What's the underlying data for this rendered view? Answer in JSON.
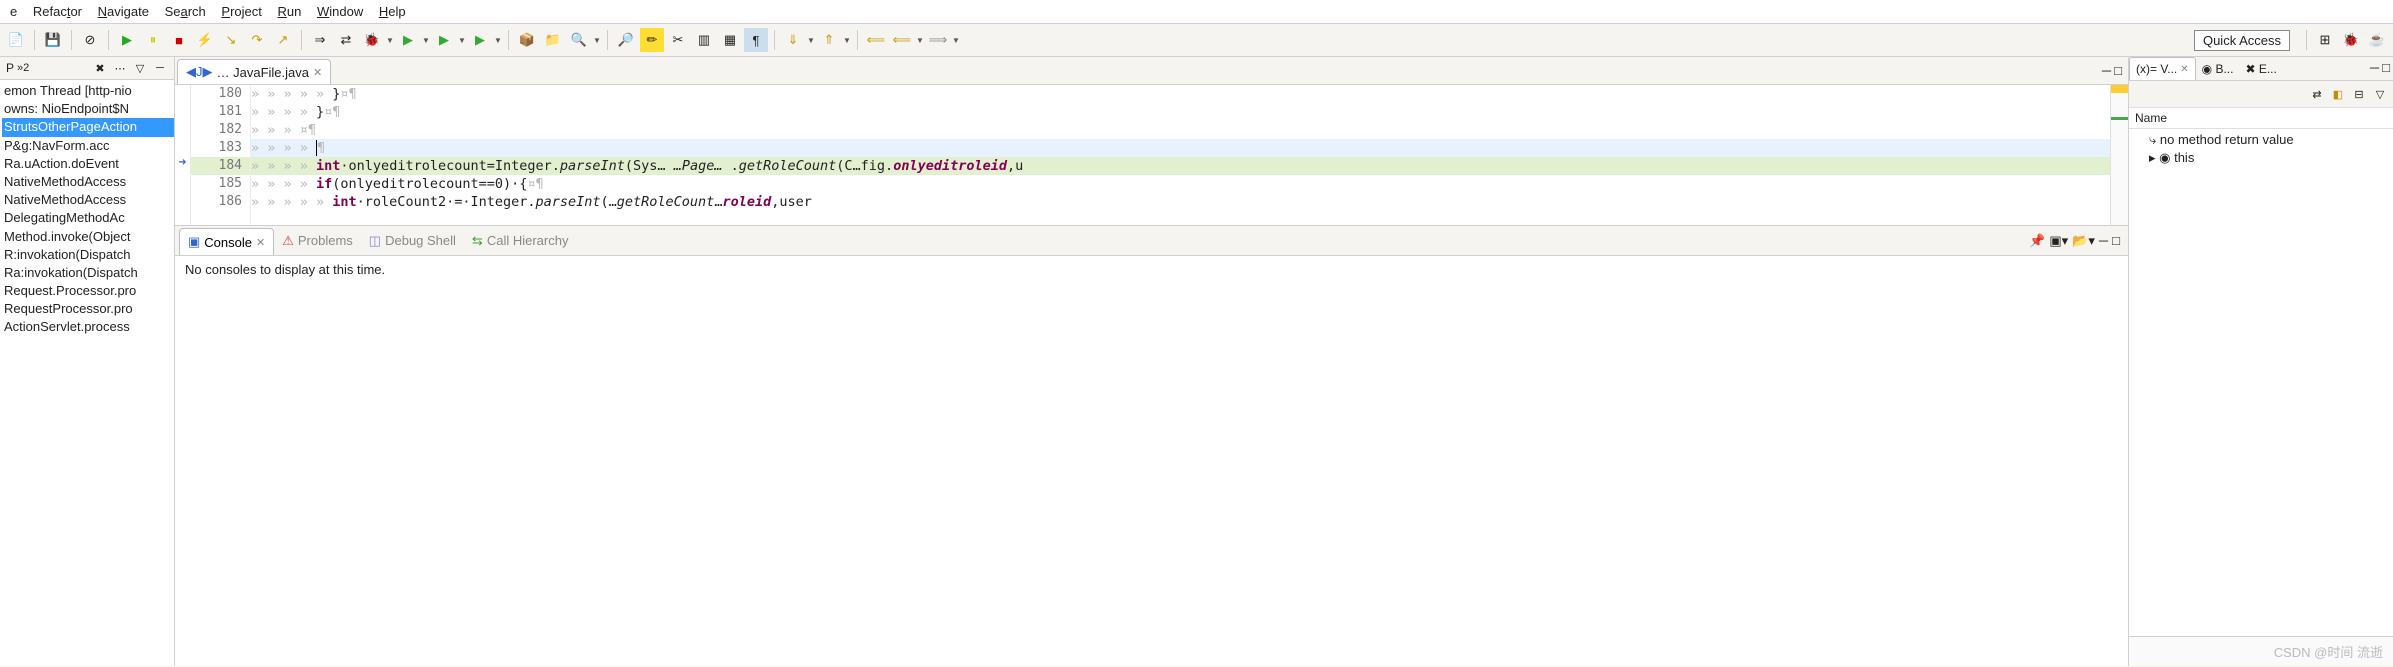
{
  "menu": [
    "e",
    "Refactor",
    "Navigate",
    "Search",
    "Project",
    "Run",
    "Window",
    "Help"
  ],
  "quick_access": "Quick Access",
  "left_pane": {
    "header": "P",
    "badge": "»2",
    "items": [
      "emon Thread [http-nio",
      "owns: NioEndpoint$N",
      "StrutsOtherPageAction",
      "P&g:NavForm.acc",
      "Ra.uAction.doEvent",
      "NativeMethodAccess",
      "NativeMethodAccess",
      "DelegatingMethodAc",
      "Method.invoke(Object",
      "R:invokation(Dispatch",
      "Ra:invokation(Dispatch",
      "Request.Processor.pro",
      "RequestProcessor.pro",
      "ActionServlet.process"
    ]
  },
  "editor": {
    "tab_label": "… JavaFile.java",
    "lines": [
      {
        "n": 180,
        "text": "                }¤¶"
      },
      {
        "n": 181,
        "text": "            }¤¶"
      },
      {
        "n": 182,
        "text": "        ¤¶"
      },
      {
        "n": 183,
        "text": "            ¤¶",
        "cursor": true
      },
      {
        "n": 184,
        "hl": true,
        "html": "<span class=\"kw\">int</span>·onlyeditrolecount=Integer.<span class=\"st\">parseInt</span>(System.…Page….<span class=\"st\">getRoleCount</span>(C…fig.<span class=\"kw st\">onlyeditroleid</span>,u"
      },
      {
        "n": 185,
        "html": "<span class=\"kw\">if</span>(onlyeditrolecount==0)·{¤¶"
      },
      {
        "n": 186,
        "html": "    <span class=\"kw\">int</span>·roleCount2·=·Integer.<span class=\"st\">parseInt</span>(…<span class=\"st\">getRoleCount</span>…<span class=\"kw st\">roleid</span>,user"
      }
    ]
  },
  "console": {
    "tabs": [
      "Console",
      "Problems",
      "Debug Shell",
      "Call Hierarchy"
    ],
    "message": "No consoles to display at this time."
  },
  "vars": {
    "tabs": [
      "(x)= V...",
      "◉ B...",
      "✖ E..."
    ],
    "col": "Name",
    "items": [
      "⤷ no method return value",
      "▸ ◉ this"
    ]
  },
  "watermark": "CSDN @时间 流逝"
}
